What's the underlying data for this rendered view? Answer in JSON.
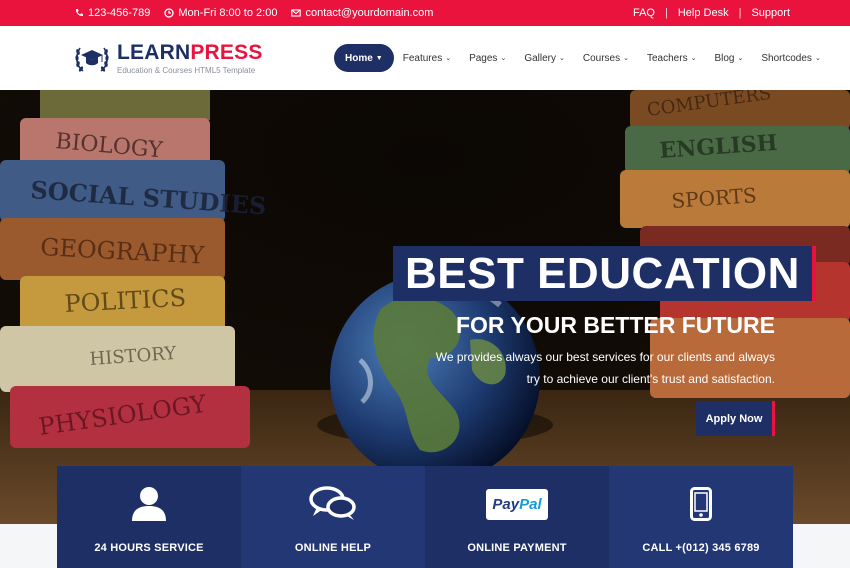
{
  "topbar": {
    "phone": "123-456-789",
    "hours": "Mon-Fri 8:00 to 2:00",
    "email": "contact@yourdomain.com",
    "links": [
      "FAQ",
      "Help Desk",
      "Support"
    ]
  },
  "header": {
    "logo_part1": "LEARN",
    "logo_part2": "PRESS",
    "logo_tagline": "Education & Courses HTML5 Template"
  },
  "nav": {
    "items": [
      {
        "label": "Home",
        "active": true
      },
      {
        "label": "Features"
      },
      {
        "label": "Pages"
      },
      {
        "label": "Gallery"
      },
      {
        "label": "Courses"
      },
      {
        "label": "Teachers"
      },
      {
        "label": "Blog"
      },
      {
        "label": "Shortcodes"
      }
    ]
  },
  "hero": {
    "title": "BEST EDUCATION",
    "subtitle": "FOR YOUR BETTER FUTURE",
    "desc_line1": "We provides always our best services for our clients and always",
    "desc_line2": "try to achieve our client's trust and satisfaction.",
    "button": "Apply Now",
    "book_labels": [
      "BIOLOGY",
      "SOCIAL STUDIES",
      "GEOGRAPHY",
      "POLITICS",
      "HISTORY",
      "PHYSIOLOGY",
      "COMPUTERS",
      "ENGLISH",
      "SPORTS"
    ]
  },
  "features": [
    {
      "label": "24 HOURS SERVICE",
      "icon": "user-icon"
    },
    {
      "label": "ONLINE HELP",
      "icon": "chat-icon"
    },
    {
      "label": "ONLINE PAYMENT",
      "icon": "paypal-icon",
      "brand_part1": "Pay",
      "brand_part2": "Pal"
    },
    {
      "label": "CALL +(012) 345 6789",
      "icon": "mobile-phone-icon"
    }
  ],
  "colors": {
    "accent": "#e9133e",
    "primary": "#1e2f66"
  }
}
